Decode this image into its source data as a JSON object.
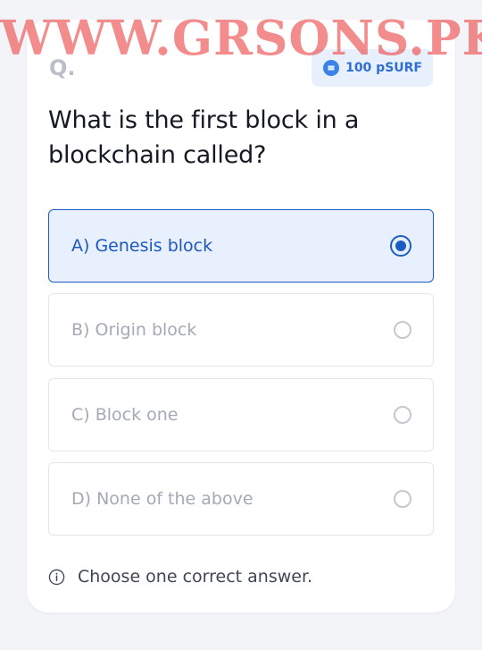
{
  "quiz": {
    "question_marker": "Q.",
    "reward": {
      "amount": "100 pSURF",
      "icon": "coin-icon"
    },
    "question": "What is the first block in a blockchain called?",
    "options": [
      {
        "label": "A) Genesis block",
        "selected": true
      },
      {
        "label": "B) Origin block",
        "selected": false
      },
      {
        "label": "C) Block one",
        "selected": false
      },
      {
        "label": "D) None of the above",
        "selected": false
      }
    ],
    "hint": "Choose one correct answer.",
    "hint_icon": "info-icon"
  },
  "watermark": "WWW.GRSONS.PK",
  "colors": {
    "accent": "#1b5ec3",
    "selected_background": "#e9f0fd",
    "reward_background": "#e7f0fc",
    "watermark": "#ee5656"
  }
}
